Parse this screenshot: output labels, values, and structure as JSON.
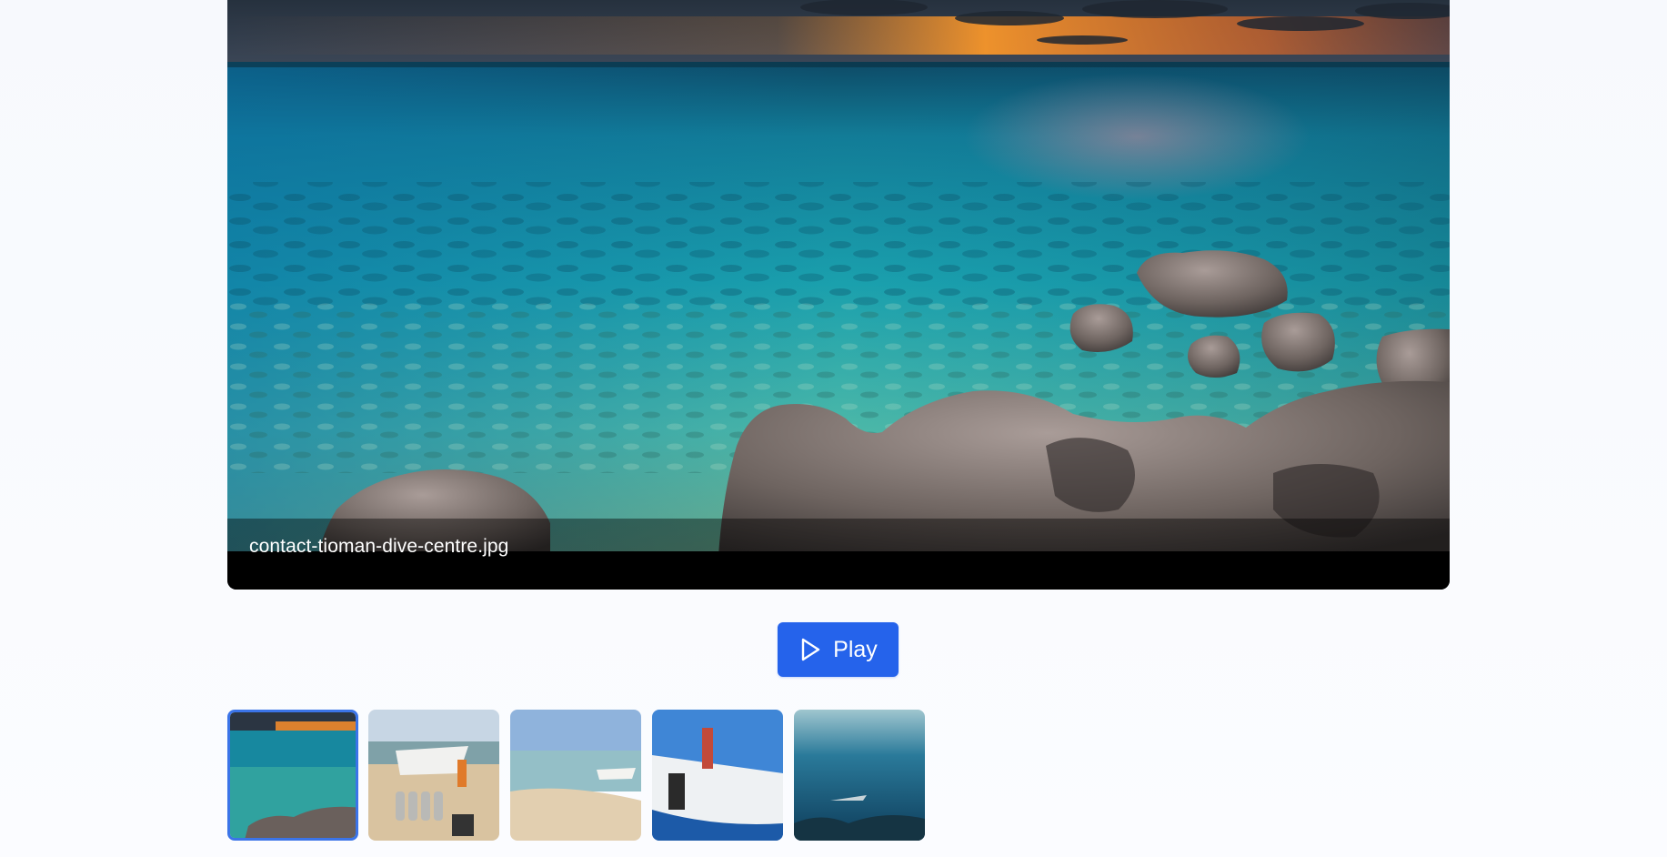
{
  "viewer": {
    "caption": "contact-tioman-dive-centre.jpg"
  },
  "controls": {
    "play_label": "Play",
    "play_icon": "play-icon"
  },
  "thumbnails": [
    {
      "subject": "sunset-reef-rocks",
      "active": true
    },
    {
      "subject": "dive-boat-tanks-beach",
      "active": false
    },
    {
      "subject": "beach-shoreline-boat",
      "active": false
    },
    {
      "subject": "diver-on-boat",
      "active": false
    },
    {
      "subject": "underwater-shark",
      "active": false
    }
  ],
  "colors": {
    "accent": "#2563eb",
    "active_border": "#3b74e8",
    "page_background": "#f8fafe"
  }
}
